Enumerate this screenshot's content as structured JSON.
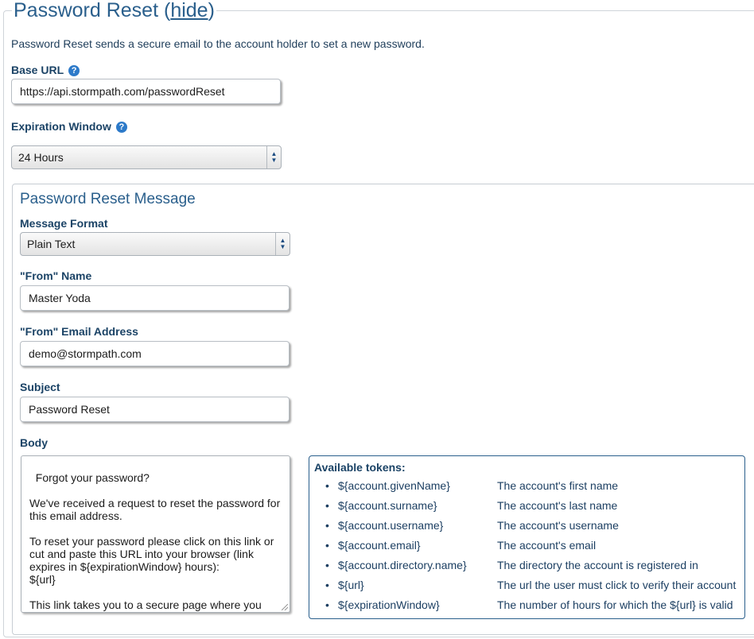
{
  "section": {
    "title": "Password Reset",
    "hide_label": "hide",
    "description": "Password Reset sends a secure email to the account holder to set a new password."
  },
  "base_url": {
    "label": "Base URL",
    "value": "https://api.stormpath.com/passwordReset"
  },
  "expiration": {
    "label": "Expiration Window",
    "value": "24 Hours"
  },
  "message": {
    "title": "Password Reset Message",
    "format_label": "Message Format",
    "format_value": "Plain Text",
    "from_name_label": "\"From\" Name",
    "from_name_value": "Master Yoda",
    "from_email_label": "\"From\" Email Address",
    "from_email_value": "demo@stormpath.com",
    "subject_label": "Subject",
    "subject_value": "Password Reset",
    "body_label": "Body",
    "body_value": "Forgot your password?\n\nWe've received a request to reset the password for this email address.\n\nTo reset your password please click on this link or cut and paste this URL into your browser (link expires in ${expirationWindow} hours):\n${url}\n\nThis link takes you to a secure page where you can change your password."
  },
  "tokens": {
    "title": "Available tokens:",
    "items": [
      {
        "name": "${account.givenName}",
        "desc": "The account's first name"
      },
      {
        "name": "${account.surname}",
        "desc": "The account's last name"
      },
      {
        "name": "${account.username}",
        "desc": "The account's username"
      },
      {
        "name": "${account.email}",
        "desc": "The account's email"
      },
      {
        "name": "${account.directory.name}",
        "desc": "The directory the account is registered in"
      },
      {
        "name": "${url}",
        "desc": "The url the user must click to verify their account"
      },
      {
        "name": "${expirationWindow}",
        "desc": "The number of hours for which the ${url} is valid"
      }
    ]
  },
  "icons": {
    "help": "help-icon",
    "select_arrows": "select-arrows-icon"
  },
  "colors": {
    "heading_blue": "#2a5f8c",
    "label_blue": "#1b4366",
    "help_icon": "#2d7ac9"
  }
}
